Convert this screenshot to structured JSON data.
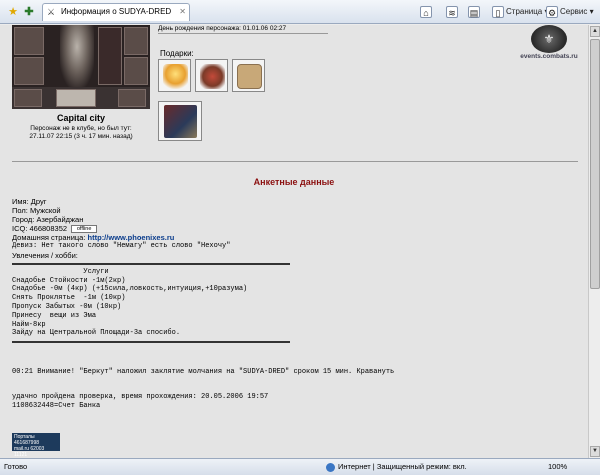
{
  "browser": {
    "tab_title": "Информация о SUDYA-DRED",
    "page_button": "Страница",
    "tools_button": "Сервис"
  },
  "profile": {
    "city": "Capital city",
    "status_line1": "Персонаж не в клубе, но был тут:",
    "status_line2": "27.11.07 22:15 (3 ч. 17 мин. назад)",
    "birthday": "День рождения персонажа: 01.01.06 02:27",
    "gifts_label": "Подарки:",
    "banner_text": "events.combats.ru"
  },
  "section": {
    "title": "Анкетные данные"
  },
  "info": {
    "name": "Имя: Друг",
    "gender": "Пол: Мужской",
    "city": "Город: Азербайджан",
    "icq_label": "ICQ: 466808352",
    "offline_badge": "offline",
    "homepage_label": "Домашняя страница: ",
    "homepage_url": "http://www.phoenixes.ru",
    "motto": "Девиз: Нет такого слово \"Немагу\" есть слово \"Нехочу\"",
    "hobbies_label": "Увлечения / хобби:",
    "services_text": "                 Услуги\nСнадобье Стойкости -1м(2кр)\nСнадобье -0м (4кр) (+15сила,ловкость,интуиция,+10разума)\nСнять Проклятье  -1м (10кр)\nПропуск Забытых -0м (10кр)\nПринесу  вещи из Эма\nНайм-8кр\nЗайду на Центральной Площади-3а спосибо.",
    "log_line": "00:21 Внимание! \"Беркут\" наложил заклятие молчания на \"SUDYA-DRED\" сроком 15 мин. Кравануть",
    "check_line": "удачно пройдена проверка, время прохождения: 20.05.2006 19:57",
    "bank_line": "1108632448=Счет Банка"
  },
  "counter": {
    "line1": "Порталы 461687998",
    "line2": "mail.ru 62003",
    "line3": "11121"
  },
  "statusbar": {
    "ready": "Готово",
    "zone": "Интернет | Защищенный режим: вкл.",
    "zoom": "100%"
  },
  "colors": {
    "section_title": "#8b1010",
    "link": "#0a3c8c"
  }
}
